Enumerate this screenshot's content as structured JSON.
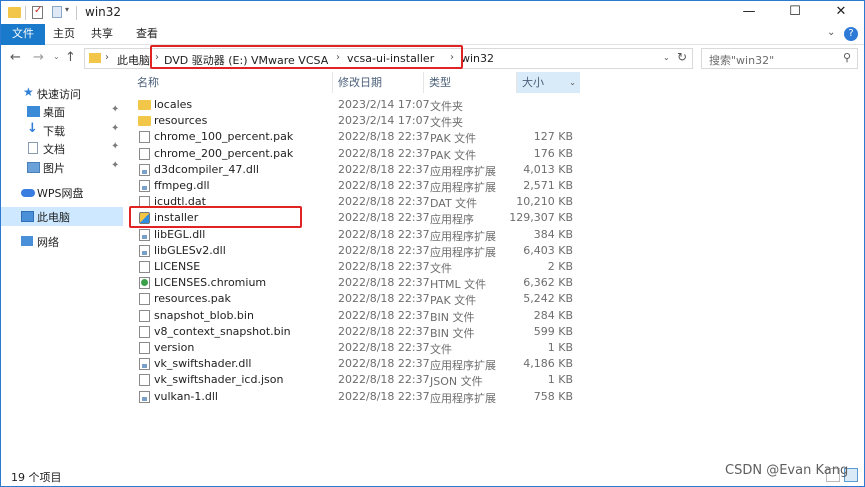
{
  "window": {
    "title": "win32",
    "minimize": "—",
    "maximize": "☐",
    "close": "✕"
  },
  "ribbon": {
    "tabs": [
      "文件",
      "主页",
      "共享",
      "查看"
    ],
    "expand": "⌄",
    "help": "?"
  },
  "nav": {
    "back": "←",
    "forward": "→",
    "recent": "⌄",
    "up": "↑"
  },
  "address": {
    "crumbs": [
      "此电脑",
      "DVD 驱动器 (E:) VMware VCSA",
      "vcsa-ui-installer",
      "win32"
    ],
    "separator": "›",
    "dropdown": "⌄",
    "refresh": "↻"
  },
  "search": {
    "placeholder": "搜索\"win32\"",
    "icon": "⚲"
  },
  "sidebar": {
    "items": [
      {
        "label": "快速访问",
        "icon": "star-icon",
        "color": "#2f7fd8"
      },
      {
        "label": "桌面",
        "icon": "desktop-icon",
        "color": "#3a8ad8",
        "pinned": true
      },
      {
        "label": "下载",
        "icon": "download-icon",
        "color": "#2f7fd8",
        "pinned": true
      },
      {
        "label": "文档",
        "icon": "document-icon",
        "color": "#8a9bb0",
        "pinned": true
      },
      {
        "label": "图片",
        "icon": "pictures-icon",
        "color": "#6aa1d8",
        "pinned": true
      },
      {
        "label": "WPS网盘",
        "icon": "cloud-icon",
        "color": "#3a7de0"
      },
      {
        "label": "此电脑",
        "icon": "computer-icon",
        "color": "#4a90d9",
        "selected": true
      },
      {
        "label": "网络",
        "icon": "network-icon",
        "color": "#4a90d9"
      }
    ],
    "pin_glyph": "📌"
  },
  "columns": {
    "name": "名称",
    "date": "修改日期",
    "type": "类型",
    "size": "大小",
    "sort_arrow": "⌄"
  },
  "files": [
    {
      "name": "locales",
      "date": "2023/2/14 17:07",
      "type": "文件夹",
      "size": "",
      "icon": "folder"
    },
    {
      "name": "resources",
      "date": "2023/2/14 17:07",
      "type": "文件夹",
      "size": "",
      "icon": "folder"
    },
    {
      "name": "chrome_100_percent.pak",
      "date": "2022/8/18 22:37",
      "type": "PAK 文件",
      "size": "127 KB",
      "icon": "file"
    },
    {
      "name": "chrome_200_percent.pak",
      "date": "2022/8/18 22:37",
      "type": "PAK 文件",
      "size": "176 KB",
      "icon": "file"
    },
    {
      "name": "d3dcompiler_47.dll",
      "date": "2022/8/18 22:37",
      "type": "应用程序扩展",
      "size": "4,013 KB",
      "icon": "dll"
    },
    {
      "name": "ffmpeg.dll",
      "date": "2022/8/18 22:37",
      "type": "应用程序扩展",
      "size": "2,571 KB",
      "icon": "dll"
    },
    {
      "name": "icudtl.dat",
      "date": "2022/8/18 22:37",
      "type": "DAT 文件",
      "size": "10,210 KB",
      "icon": "file"
    },
    {
      "name": "installer",
      "date": "2022/8/18 22:37",
      "type": "应用程序",
      "size": "129,307 KB",
      "icon": "app"
    },
    {
      "name": "libEGL.dll",
      "date": "2022/8/18 22:37",
      "type": "应用程序扩展",
      "size": "384 KB",
      "icon": "dll"
    },
    {
      "name": "libGLESv2.dll",
      "date": "2022/8/18 22:37",
      "type": "应用程序扩展",
      "size": "6,403 KB",
      "icon": "dll"
    },
    {
      "name": "LICENSE",
      "date": "2022/8/18 22:37",
      "type": "文件",
      "size": "2 KB",
      "icon": "file"
    },
    {
      "name": "LICENSES.chromium",
      "date": "2022/8/18 22:37",
      "type": "HTML 文件",
      "size": "6,362 KB",
      "icon": "html"
    },
    {
      "name": "resources.pak",
      "date": "2022/8/18 22:37",
      "type": "PAK 文件",
      "size": "5,242 KB",
      "icon": "file"
    },
    {
      "name": "snapshot_blob.bin",
      "date": "2022/8/18 22:37",
      "type": "BIN 文件",
      "size": "284 KB",
      "icon": "file"
    },
    {
      "name": "v8_context_snapshot.bin",
      "date": "2022/8/18 22:37",
      "type": "BIN 文件",
      "size": "599 KB",
      "icon": "file"
    },
    {
      "name": "version",
      "date": "2022/8/18 22:37",
      "type": "文件",
      "size": "1 KB",
      "icon": "file"
    },
    {
      "name": "vk_swiftshader.dll",
      "date": "2022/8/18 22:37",
      "type": "应用程序扩展",
      "size": "4,186 KB",
      "icon": "dll"
    },
    {
      "name": "vk_swiftshader_icd.json",
      "date": "2022/8/18 22:37",
      "type": "JSON 文件",
      "size": "1 KB",
      "icon": "file"
    },
    {
      "name": "vulkan-1.dll",
      "date": "2022/8/18 22:37",
      "type": "应用程序扩展",
      "size": "758 KB",
      "icon": "dll"
    }
  ],
  "status": {
    "count": "19 个项目"
  },
  "watermark": "CSDN @Evan Kang",
  "colors": {
    "accent": "#1979ca",
    "selection": "#cde8ff",
    "annotation": "#e02424"
  }
}
